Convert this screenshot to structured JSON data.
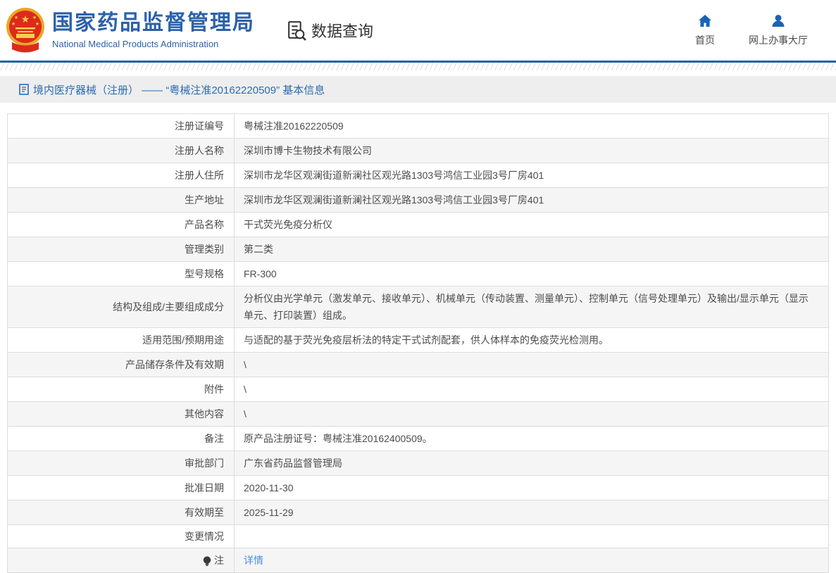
{
  "colors": {
    "brand_blue": "#2c61a8",
    "bar_blue": "#1f63a8",
    "link_blue": "#4a90d9",
    "emblem_red": "#dd2a1b",
    "emblem_gold": "#f2c94c",
    "text_dark": "#4d4d4d",
    "alt_row_bg": "#f5f5f5"
  },
  "header": {
    "title_cn": "国家药品监督管理局",
    "subtitle_en": "National Medical Products Administration",
    "section": {
      "icon": "doc-search-icon",
      "label": "数据查询"
    },
    "nav": [
      {
        "icon": "home-icon",
        "label": "首页"
      },
      {
        "icon": "user-icon",
        "label": "网上办事大厅"
      }
    ]
  },
  "breadcrumb": {
    "icon": "document-icon",
    "text": "境内医疗器械（注册） —— “粤械注准20162220509” 基本信息"
  },
  "table": {
    "rows": [
      {
        "label": "注册证编号",
        "value": "粤械注准20162220509"
      },
      {
        "label": "注册人名称",
        "value": "深圳市博卡生物技术有限公司"
      },
      {
        "label": "注册人住所",
        "value": "深圳市龙华区观澜街道新澜社区观光路1303号鸿信工业园3号厂房401"
      },
      {
        "label": "生产地址",
        "value": "深圳市龙华区观澜街道新澜社区观光路1303号鸿信工业园3号厂房401"
      },
      {
        "label": "产品名称",
        "value": "干式荧光免疫分析仪"
      },
      {
        "label": "管理类别",
        "value": "第二类"
      },
      {
        "label": "型号规格",
        "value": "FR-300"
      },
      {
        "label": "结构及组成/主要组成成分",
        "value": "分析仪由光学单元（激发单元、接收单元）、机械单元（传动装置、测量单元）、控制单元（信号处理单元）及输出/显示单元（显示单元、打印装置）组成。"
      },
      {
        "label": "适用范围/预期用途",
        "value": "与适配的基于荧光免疫层析法的特定干式试剂配套，供人体样本的免疫荧光检测用。"
      },
      {
        "label": "产品储存条件及有效期",
        "value": "\\"
      },
      {
        "label": "附件",
        "value": "\\"
      },
      {
        "label": "其他内容",
        "value": "\\"
      },
      {
        "label": "备注",
        "value": "原产品注册证号：粤械注准20162400509。"
      },
      {
        "label": "审批部门",
        "value": "广东省药品监督管理局"
      },
      {
        "label": "批准日期",
        "value": "2020-11-30"
      },
      {
        "label": "有效期至",
        "value": "2025-11-29"
      },
      {
        "label": "变更情况",
        "value": ""
      },
      {
        "label": "注",
        "label_icon": "lightbulb-icon",
        "value": "详情",
        "link": true
      }
    ]
  }
}
